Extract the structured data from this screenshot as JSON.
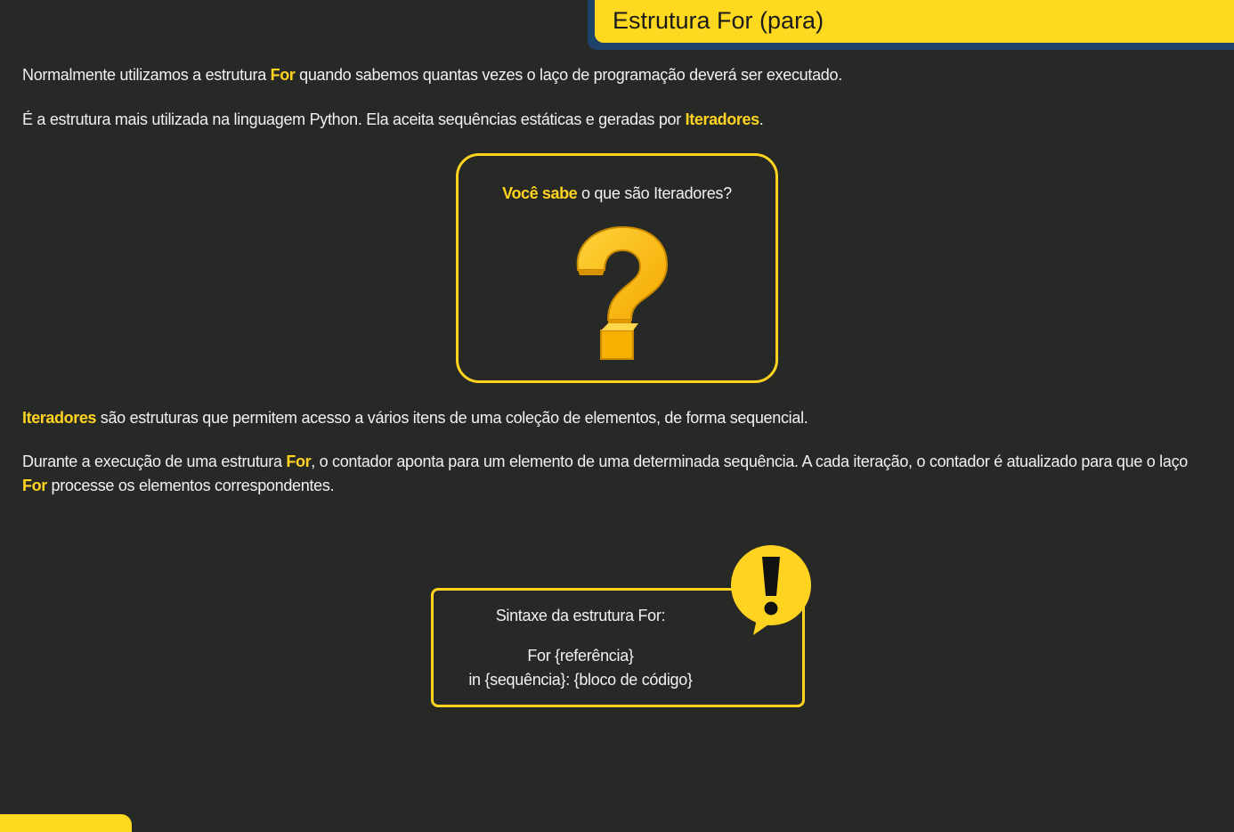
{
  "title": "Estrutura For (para)",
  "p1": {
    "before": "Normalmente utilizamos a estrutura ",
    "kw": "For",
    "after": " quando sabemos quantas vezes o laço de programação deverá ser executado."
  },
  "p2": {
    "before": "É a estrutura mais utilizada na linguagem Python. Ela aceita sequências estáticas e geradas por ",
    "kw": "Iteradores",
    "after": "."
  },
  "question_card": {
    "highlight": "Você sabe",
    "rest": " o que são Iteradores?",
    "icon": "question-mark-icon"
  },
  "p3": {
    "kw": "Iteradores",
    "after": " são estruturas que permitem acesso a vários itens de uma coleção de elementos, de forma sequencial."
  },
  "p4": {
    "before": "Durante a execução de uma estrutura ",
    "kw1": "For",
    "middle": ", o contador aponta para um elemento de uma determinada sequência. A cada iteração, o contador é atualizado para que o laço ",
    "kw2": "For",
    "after": " processe os elementos correspondentes."
  },
  "syntax_card": {
    "title": "Sintaxe da estrutura For:",
    "line1": "For {referência}",
    "line2": "in {sequência}: {bloco de código}",
    "icon": "exclamation-bubble-icon"
  },
  "colors": {
    "background": "#272927",
    "accent": "#ffd31f",
    "banner_shadow": "#1f4268",
    "text": "#f1f1f1"
  }
}
